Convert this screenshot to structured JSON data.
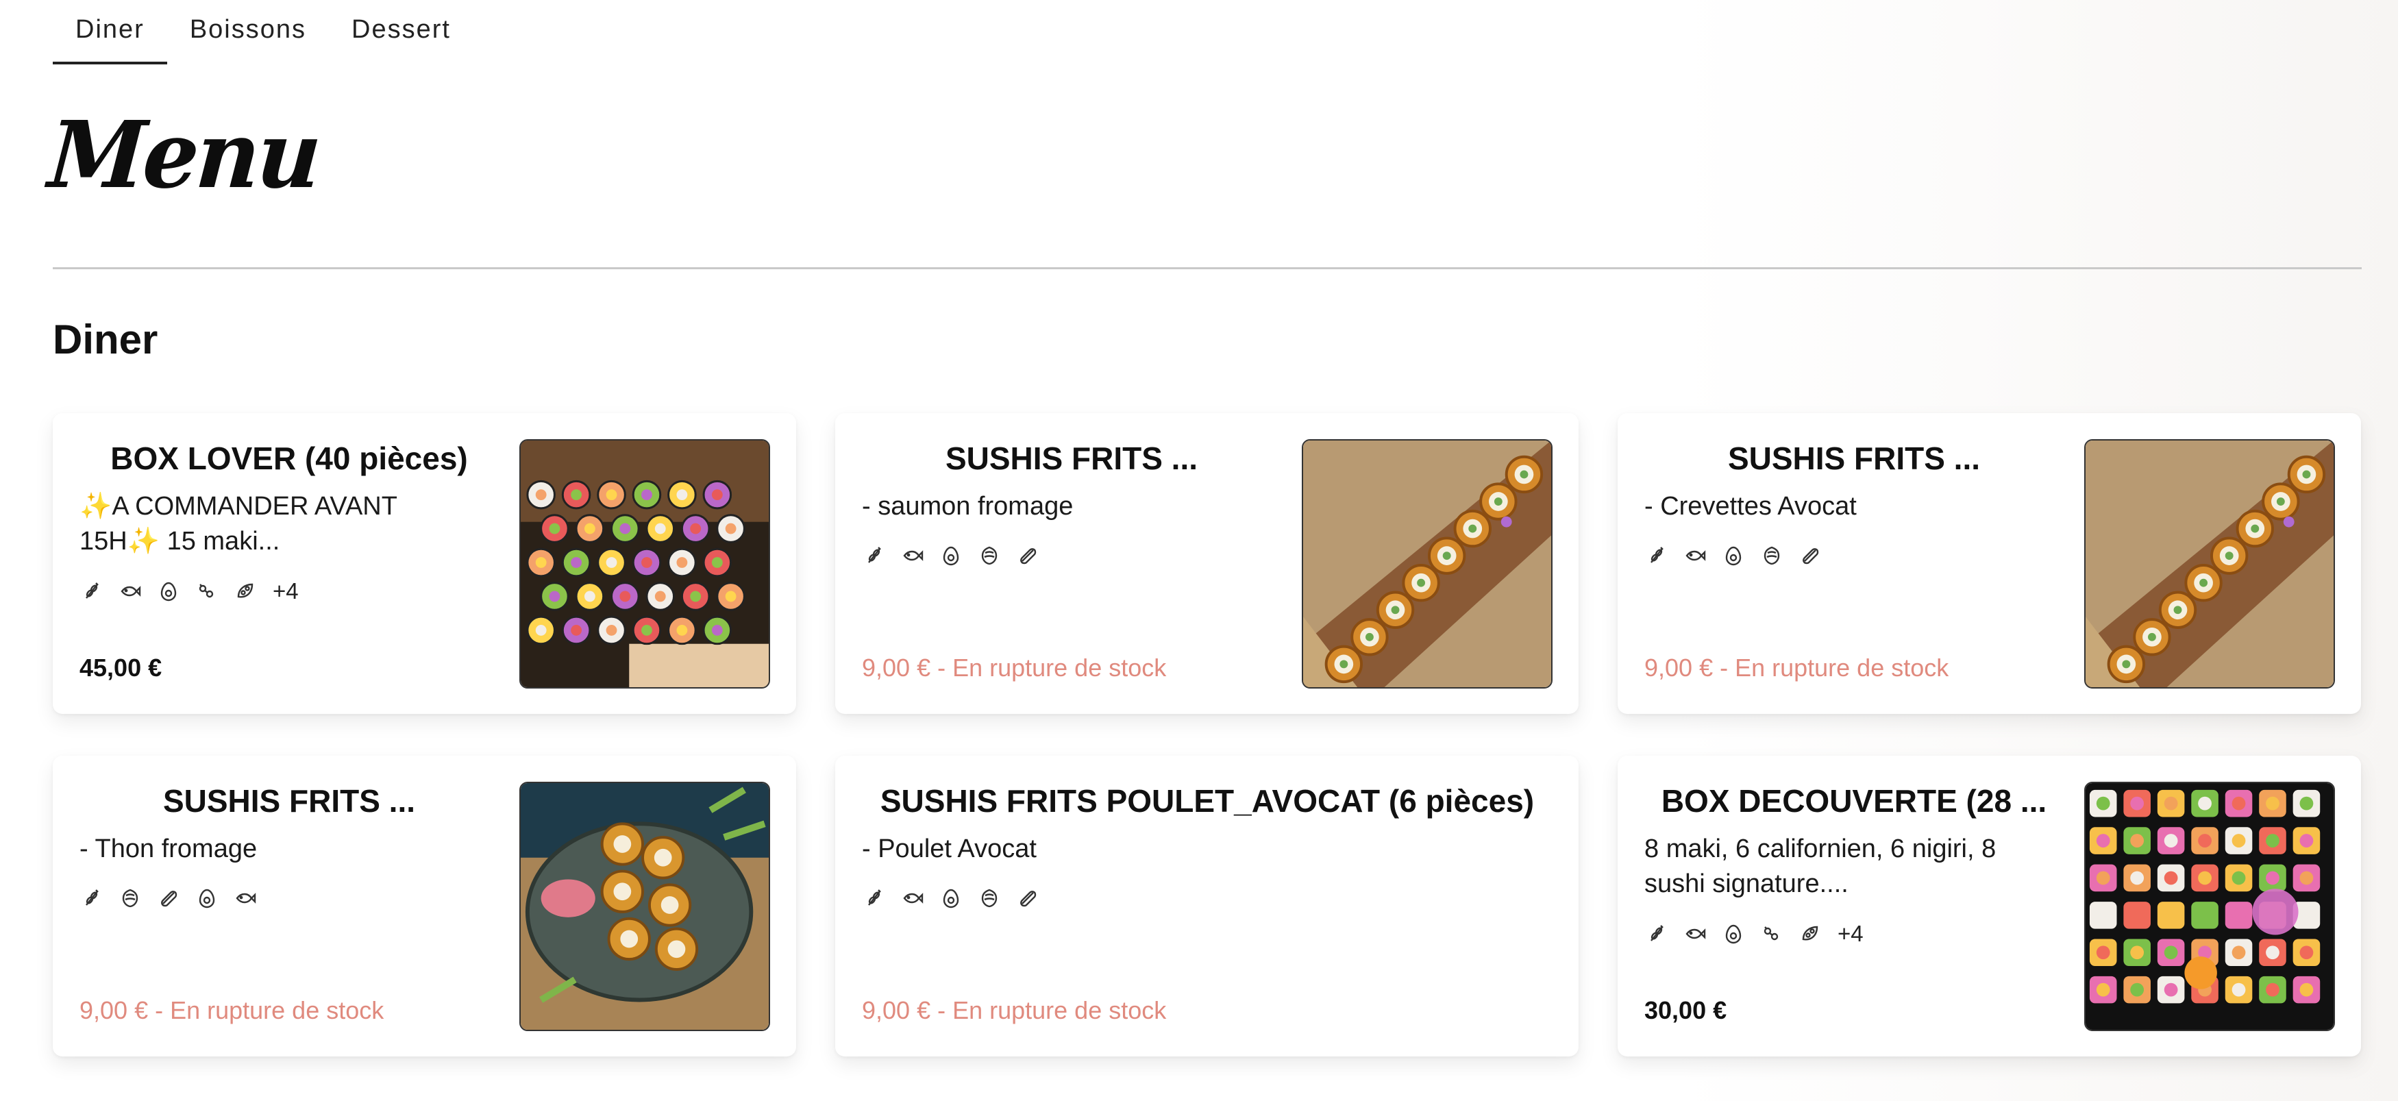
{
  "tabs": [
    {
      "label": "Diner",
      "active": true
    },
    {
      "label": "Boissons",
      "active": false
    },
    {
      "label": "Dessert",
      "active": false
    }
  ],
  "menu_title": "Menu",
  "section_title": "Diner",
  "cards": [
    {
      "title": "BOX LOVER (40 pièces)",
      "desc": "✨A COMMANDER AVANT 15H✨ 15 maki...",
      "allergens": [
        "sesame-icon",
        "fish-icon",
        "egg-icon",
        "mustard-icon",
        "soy-icon"
      ],
      "more": "+4",
      "price": "45,00 €",
      "out_of_stock": false,
      "image": "sushi-platter-photo"
    },
    {
      "title": "SUSHIS FRITS ...",
      "desc": "- saumon fromage",
      "allergens": [
        "sesame-icon",
        "fish-icon",
        "egg-icon",
        "gluten-icon",
        "milk-icon"
      ],
      "more": "",
      "price": "9,00 € - En rupture de stock",
      "out_of_stock": true,
      "image": "fried-sushi-photo"
    },
    {
      "title": "SUSHIS FRITS ...",
      "desc": "- Crevettes Avocat",
      "allergens": [
        "sesame-icon",
        "fish-icon",
        "egg-icon",
        "gluten-icon",
        "milk-icon"
      ],
      "more": "",
      "price": "9,00 € - En rupture de stock",
      "out_of_stock": true,
      "image": "fried-sushi-photo"
    },
    {
      "title": "SUSHIS FRITS ...",
      "desc": "- Thon fromage",
      "allergens": [
        "sesame-icon",
        "gluten-icon",
        "milk-icon",
        "egg-icon",
        "fish-icon"
      ],
      "more": "",
      "price": "9,00 € - En rupture de stock",
      "out_of_stock": true,
      "image": "fried-sushi-plate-photo"
    },
    {
      "title": "SUSHIS FRITS POULET_AVOCAT (6 pièces)",
      "desc": "- Poulet Avocat",
      "allergens": [
        "sesame-icon",
        "fish-icon",
        "egg-icon",
        "gluten-icon",
        "milk-icon"
      ],
      "more": "",
      "price": "9,00 € - En rupture de stock",
      "out_of_stock": true,
      "image": ""
    },
    {
      "title": "BOX DECOUVERTE (28 ...",
      "desc": "8 maki, 6 californien, 6 nigiri, 8 sushi signature....",
      "allergens": [
        "sesame-icon",
        "fish-icon",
        "egg-icon",
        "mustard-icon",
        "soy-icon"
      ],
      "more": "+4",
      "price": "30,00 €",
      "out_of_stock": false,
      "image": "sushi-box-photo"
    }
  ],
  "colors": {
    "out_of_stock": "#e08a7e",
    "text": "#111111",
    "divider": "#c9c9c9"
  }
}
